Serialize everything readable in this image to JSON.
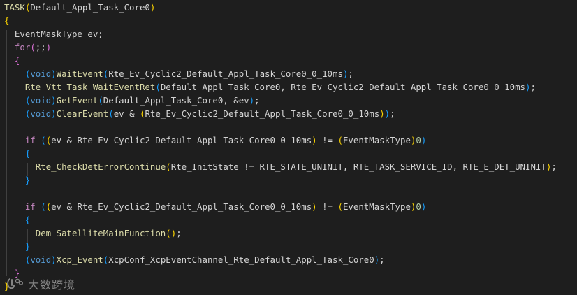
{
  "lines": [
    [
      {
        "t": "TASK",
        "c": "fn"
      },
      {
        "t": "(",
        "c": "b1"
      },
      {
        "t": "Default_Appl_Task_Core0",
        "c": "id"
      },
      {
        "t": ")",
        "c": "b1"
      }
    ],
    [
      {
        "t": "{",
        "c": "b1"
      }
    ],
    [
      {
        "t": "  EventMaskType ev;",
        "c": "id"
      }
    ],
    [
      {
        "t": "  ",
        "c": "id"
      },
      {
        "t": "for",
        "c": "kw"
      },
      {
        "t": "(",
        "c": "b2"
      },
      {
        "t": ";;",
        "c": "id"
      },
      {
        "t": ")",
        "c": "b2"
      }
    ],
    [
      {
        "t": "  ",
        "c": "id"
      },
      {
        "t": "{",
        "c": "b2"
      }
    ],
    [
      {
        "t": "    ",
        "c": "id"
      },
      {
        "t": "(",
        "c": "b3"
      },
      {
        "t": "void",
        "c": "ty"
      },
      {
        "t": ")",
        "c": "b3"
      },
      {
        "t": "WaitEvent",
        "c": "fn"
      },
      {
        "t": "(",
        "c": "b3"
      },
      {
        "t": "Rte_Ev_Cyclic2_Default_Appl_Task_Core0_0_10ms",
        "c": "id"
      },
      {
        "t": ")",
        "c": "b3"
      },
      {
        "t": ";",
        "c": "id"
      }
    ],
    [
      {
        "t": "    ",
        "c": "id"
      },
      {
        "t": "Rte_Vtt_Task_WaitEventRet",
        "c": "fn"
      },
      {
        "t": "(",
        "c": "b3"
      },
      {
        "t": "Default_Appl_Task_Core0, Rte_Ev_Cyclic2_Default_Appl_Task_Core0_0_10ms",
        "c": "id"
      },
      {
        "t": ")",
        "c": "b3"
      },
      {
        "t": ";",
        "c": "id"
      }
    ],
    [
      {
        "t": "    ",
        "c": "id"
      },
      {
        "t": "(",
        "c": "b3"
      },
      {
        "t": "void",
        "c": "ty"
      },
      {
        "t": ")",
        "c": "b3"
      },
      {
        "t": "GetEvent",
        "c": "fn"
      },
      {
        "t": "(",
        "c": "b3"
      },
      {
        "t": "Default_Appl_Task_Core0, &ev",
        "c": "id"
      },
      {
        "t": ")",
        "c": "b3"
      },
      {
        "t": ";",
        "c": "id"
      }
    ],
    [
      {
        "t": "    ",
        "c": "id"
      },
      {
        "t": "(",
        "c": "b3"
      },
      {
        "t": "void",
        "c": "ty"
      },
      {
        "t": ")",
        "c": "b3"
      },
      {
        "t": "ClearEvent",
        "c": "fn"
      },
      {
        "t": "(",
        "c": "b3"
      },
      {
        "t": "ev & ",
        "c": "id"
      },
      {
        "t": "(",
        "c": "b1"
      },
      {
        "t": "Rte_Ev_Cyclic2_Default_Appl_Task_Core0_0_10ms",
        "c": "id"
      },
      {
        "t": ")",
        "c": "b1"
      },
      {
        "t": ")",
        "c": "b3"
      },
      {
        "t": ";",
        "c": "id"
      }
    ],
    [],
    [
      {
        "t": "    ",
        "c": "id"
      },
      {
        "t": "if",
        "c": "kw"
      },
      {
        "t": " ",
        "c": "id"
      },
      {
        "t": "(",
        "c": "b3"
      },
      {
        "t": "(",
        "c": "b1"
      },
      {
        "t": "ev & Rte_Ev_Cyclic2_Default_Appl_Task_Core0_0_10ms",
        "c": "id"
      },
      {
        "t": ")",
        "c": "b1"
      },
      {
        "t": " != ",
        "c": "id"
      },
      {
        "t": "(",
        "c": "b1"
      },
      {
        "t": "EventMaskType",
        "c": "id"
      },
      {
        "t": ")",
        "c": "b1"
      },
      {
        "t": "0",
        "c": "nm"
      },
      {
        "t": ")",
        "c": "b3"
      }
    ],
    [
      {
        "t": "    ",
        "c": "id"
      },
      {
        "t": "{",
        "c": "b3"
      }
    ],
    [
      {
        "t": "      ",
        "c": "id"
      },
      {
        "t": "Rte_CheckDetErrorContinue",
        "c": "fn"
      },
      {
        "t": "(",
        "c": "b1"
      },
      {
        "t": "Rte_InitState != RTE_STATE_UNINIT, RTE_TASK_SERVICE_ID, RTE_E_DET_UNINIT",
        "c": "id"
      },
      {
        "t": ")",
        "c": "b1"
      },
      {
        "t": ";",
        "c": "id"
      }
    ],
    [
      {
        "t": "    ",
        "c": "id"
      },
      {
        "t": "}",
        "c": "b3"
      }
    ],
    [],
    [
      {
        "t": "    ",
        "c": "id"
      },
      {
        "t": "if",
        "c": "kw"
      },
      {
        "t": " ",
        "c": "id"
      },
      {
        "t": "(",
        "c": "b3"
      },
      {
        "t": "(",
        "c": "b1"
      },
      {
        "t": "ev & Rte_Ev_Cyclic2_Default_Appl_Task_Core0_0_10ms",
        "c": "id"
      },
      {
        "t": ")",
        "c": "b1"
      },
      {
        "t": " != ",
        "c": "id"
      },
      {
        "t": "(",
        "c": "b1"
      },
      {
        "t": "EventMaskType",
        "c": "id"
      },
      {
        "t": ")",
        "c": "b1"
      },
      {
        "t": "0",
        "c": "nm"
      },
      {
        "t": ")",
        "c": "b3"
      }
    ],
    [
      {
        "t": "    ",
        "c": "id"
      },
      {
        "t": "{",
        "c": "b3"
      }
    ],
    [
      {
        "t": "      ",
        "c": "id"
      },
      {
        "t": "Dem_SatelliteMainFunction",
        "c": "fn"
      },
      {
        "t": "(",
        "c": "b1"
      },
      {
        "t": ")",
        "c": "b1"
      },
      {
        "t": ";",
        "c": "id"
      }
    ],
    [
      {
        "t": "    ",
        "c": "id"
      },
      {
        "t": "}",
        "c": "b3"
      }
    ],
    [
      {
        "t": "    ",
        "c": "id"
      },
      {
        "t": "(",
        "c": "b3"
      },
      {
        "t": "void",
        "c": "ty"
      },
      {
        "t": ")",
        "c": "b3"
      },
      {
        "t": "Xcp_Event",
        "c": "fn"
      },
      {
        "t": "(",
        "c": "b3"
      },
      {
        "t": "XcpConf_XcpEventChannel_Rte_Default_Appl_Task_Core0",
        "c": "id"
      },
      {
        "t": ")",
        "c": "b3"
      },
      {
        "t": ";",
        "c": "id"
      }
    ],
    [
      {
        "t": "  ",
        "c": "id"
      },
      {
        "t": "}",
        "c": "b2"
      }
    ],
    [
      {
        "t": "}",
        "c": "b1"
      }
    ]
  ],
  "watermark": {
    "text": "大数跨境",
    "logo_icon": "brand-logo-icon"
  },
  "colors": {
    "background": "#1e1e1e",
    "keyword": "#c586c0",
    "type": "#569cd6",
    "function": "#dcdcaa",
    "identifier": "#d4d4d4",
    "number": "#b5cea8",
    "bracket_1": "#ffd700",
    "bracket_2": "#da70d6",
    "bracket_3": "#179fff"
  }
}
